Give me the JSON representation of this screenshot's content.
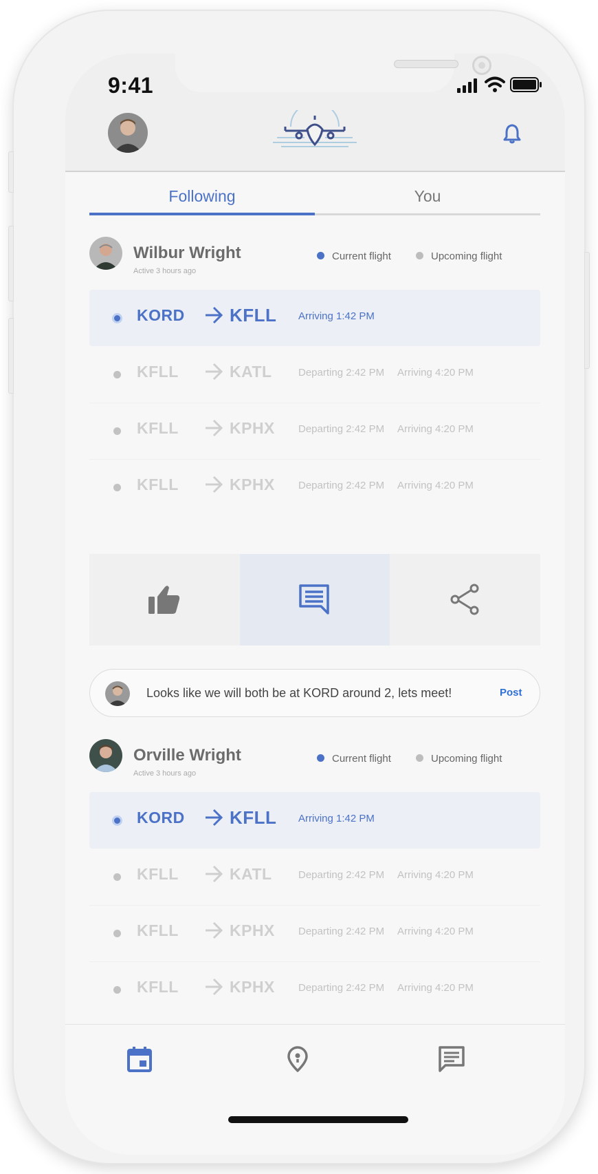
{
  "status": {
    "time": "9:41"
  },
  "header": {
    "logo": "airplane-logo",
    "accent": "#4b72c6"
  },
  "tabs": [
    {
      "label": "Following",
      "active": true
    },
    {
      "label": "You",
      "active": false
    }
  ],
  "legend": {
    "current": "Current flight",
    "upcoming": "Upcoming flight",
    "current_color": "#4b72c6",
    "upcoming_color": "#bdbdbd"
  },
  "posts": [
    {
      "name": "Wilbur Wright",
      "active": "Active 3 hours ago",
      "flights": [
        {
          "from": "KORD",
          "to": "KFLL",
          "departing": "",
          "arriving": "Arriving 1:42 PM",
          "current": true
        },
        {
          "from": "KFLL",
          "to": "KATL",
          "departing": "Departing 2:42 PM",
          "arriving": "Arriving 4:20 PM",
          "current": false
        },
        {
          "from": "KFLL",
          "to": "KPHX",
          "departing": "Departing 2:42 PM",
          "arriving": "Arriving 4:20 PM",
          "current": false
        },
        {
          "from": "KFLL",
          "to": "KPHX",
          "departing": "Departing 2:42 PM",
          "arriving": "Arriving 4:20 PM",
          "current": false
        }
      ]
    },
    {
      "name": "Orville Wright",
      "active": "Active 3 hours ago",
      "flights": [
        {
          "from": "KORD",
          "to": "KFLL",
          "departing": "",
          "arriving": "Arriving 1:42 PM",
          "current": true
        },
        {
          "from": "KFLL",
          "to": "KATL",
          "departing": "Departing 2:42 PM",
          "arriving": "Arriving 4:20 PM",
          "current": false
        },
        {
          "from": "KFLL",
          "to": "KPHX",
          "departing": "Departing 2:42 PM",
          "arriving": "Arriving 4:20 PM",
          "current": false
        },
        {
          "from": "KFLL",
          "to": "KPHX",
          "departing": "Departing 2:42 PM",
          "arriving": "Arriving 4:20 PM",
          "current": false
        }
      ]
    }
  ],
  "actions": [
    {
      "icon": "thumbs-up-icon",
      "selected": false
    },
    {
      "icon": "comment-icon",
      "selected": true
    },
    {
      "icon": "share-icon",
      "selected": false
    }
  ],
  "comment": {
    "text": "Looks like we will both be at KORD around 2, lets meet!",
    "post_label": "Post"
  },
  "bottom_nav": [
    {
      "icon": "calendar-icon",
      "active": true
    },
    {
      "icon": "location-pin-icon",
      "active": false
    },
    {
      "icon": "messages-icon",
      "active": false
    }
  ]
}
